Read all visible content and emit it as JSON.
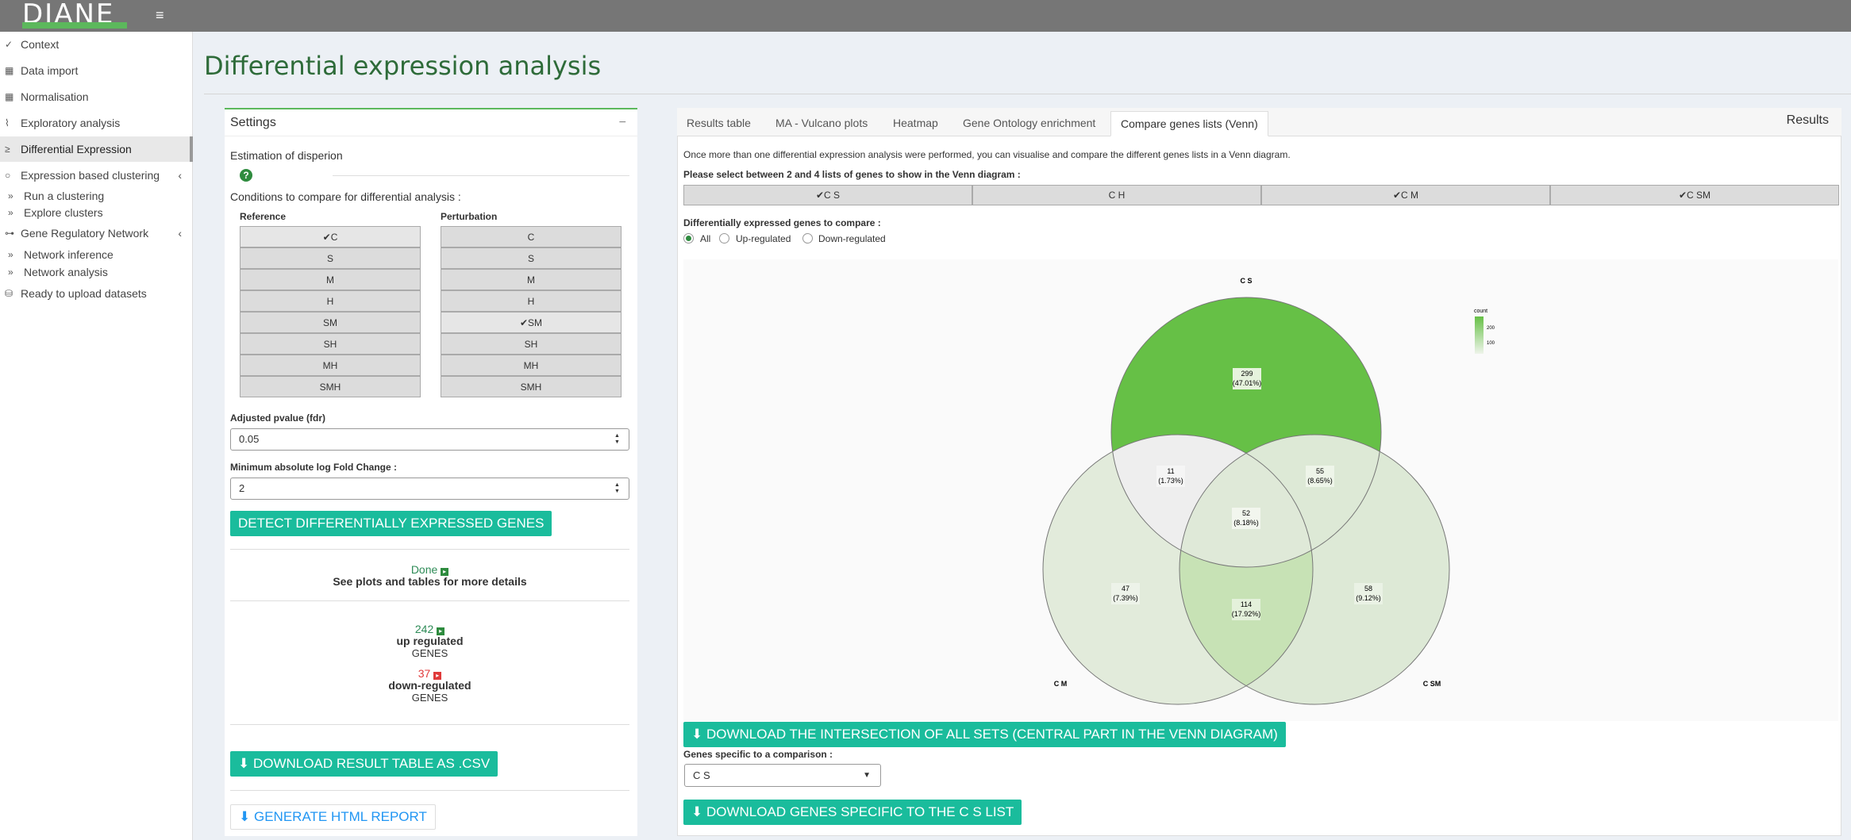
{
  "app": {
    "logo": "DIANE",
    "menu_icon": "hamburger-icon"
  },
  "sidebar": {
    "items": [
      {
        "label": "Context",
        "icon": "sprout-icon"
      },
      {
        "label": "Data import",
        "icon": "table-icon"
      },
      {
        "label": "Normalisation",
        "icon": "table-icon"
      },
      {
        "label": "Exploratory analysis",
        "icon": "chart-line-icon"
      },
      {
        "label": "Differential Expression",
        "icon": "sort-amount-icon"
      },
      {
        "label": "Expression based clustering",
        "icon": "circle-icon"
      },
      {
        "label": "Gene Regulatory Network",
        "icon": "network-icon"
      },
      {
        "label": "Ready to upload datasets",
        "icon": "database-icon"
      }
    ],
    "clustering_sub": [
      "Run a clustering",
      "Explore clusters"
    ],
    "network_sub": [
      "Network inference",
      "Network analysis"
    ]
  },
  "page": {
    "title": "Differential expression analysis"
  },
  "settings": {
    "title": "Settings",
    "dispersion_label": "Estimation of disperion",
    "conditions_label": "Conditions to compare for differential analysis :",
    "reference_label": "Reference",
    "perturbation_label": "Perturbation",
    "reference": [
      "C",
      "S",
      "M",
      "H",
      "SM",
      "SH",
      "MH",
      "SMH"
    ],
    "reference_selected": "C",
    "perturbation": [
      "C",
      "S",
      "M",
      "H",
      "SM",
      "SH",
      "MH",
      "SMH"
    ],
    "perturbation_selected": "SM",
    "pvalue_label": "Adjusted pvalue (fdr)",
    "pvalue": "0.05",
    "fc_label": "Minimum absolute log Fold Change :",
    "fc": "2",
    "detect_button": "DETECT DIFFERENTIALLY EXPRESSED GENES",
    "done_label": "Done",
    "details_label": "See plots and tables for more details",
    "up_count": "242",
    "up_label": "up regulated",
    "genes_label": "GENES",
    "down_count": "37",
    "down_label": "down-regulated",
    "download_csv_button": "DOWNLOAD RESULT TABLE AS .CSV",
    "report_button": "GENERATE HTML REPORT"
  },
  "results": {
    "label": "Results",
    "tabs": [
      "Results table",
      "MA - Vulcano plots",
      "Heatmap",
      "Gene Ontology enrichment",
      "Compare genes lists (Venn)"
    ],
    "active_tab": "Compare genes lists (Venn)",
    "intro": "Once more than one differential expression analysis were performed, you can visualise and compare the different genes lists in a Venn diagram.",
    "select_label": "Please select between 2 and 4 lists of genes to show in the Venn diagram :",
    "lists": [
      {
        "label": "C S",
        "checked": true
      },
      {
        "label": "C H",
        "checked": false
      },
      {
        "label": "C M",
        "checked": true
      },
      {
        "label": "C SM",
        "checked": true
      }
    ],
    "compare_label": "Differentially expressed genes to compare :",
    "radio_options": [
      "All",
      "Up-regulated",
      "Down-regulated"
    ],
    "radio_selected": "All",
    "intersection_button": "DOWNLOAD THE INTERSECTION OF ALL SETS (CENTRAL PART IN THE VENN DIAGRAM)",
    "specific_label": "Genes specific to a comparison :",
    "specific_value": "C S",
    "specific_button": "DOWNLOAD GENES SPECIFIC TO THE C S LIST"
  },
  "venn": {
    "set_labels": [
      "C S",
      "C M",
      "C SM"
    ],
    "legend_title": "count",
    "legend_ticks": [
      "200",
      "100"
    ],
    "regions": [
      {
        "count": "299",
        "pct": "(47.01%)"
      },
      {
        "count": "11",
        "pct": "(1.73%)"
      },
      {
        "count": "55",
        "pct": "(8.65%)"
      },
      {
        "count": "52",
        "pct": "(8.18%)"
      },
      {
        "count": "47",
        "pct": "(7.39%)"
      },
      {
        "count": "114",
        "pct": "(17.92%)"
      },
      {
        "count": "58",
        "pct": "(9.12%)"
      }
    ],
    "colors": {
      "high": "#66c046",
      "low": "#eef4ea"
    }
  }
}
